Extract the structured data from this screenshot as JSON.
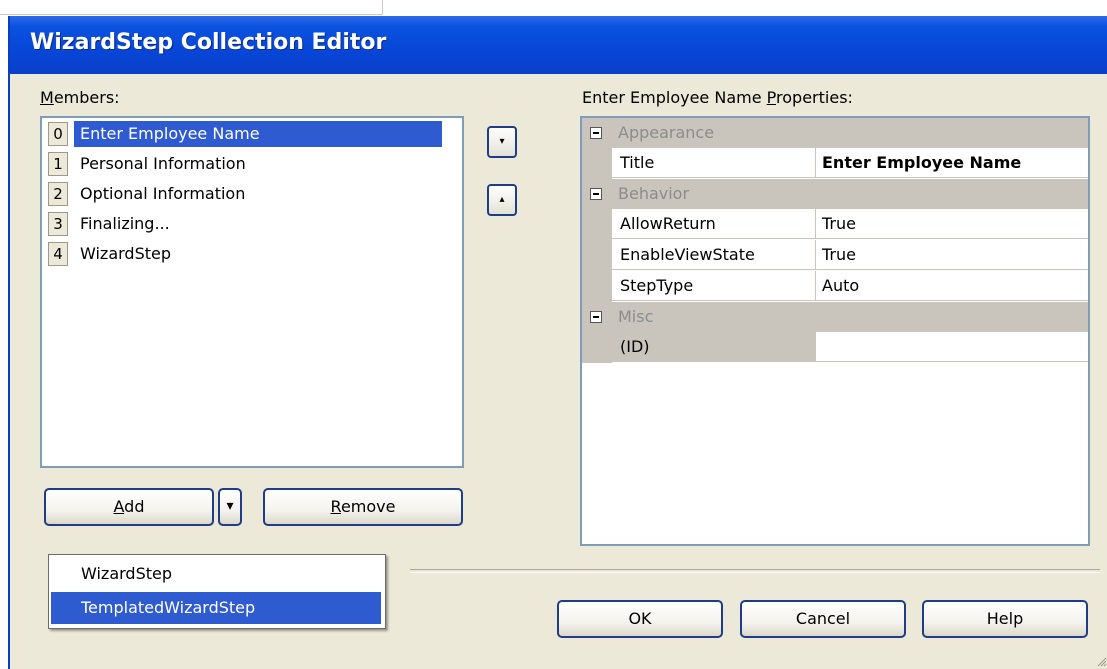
{
  "window": {
    "title": "WizardStep Collection Editor"
  },
  "members": {
    "label_hotkey": "M",
    "label_rest": "embers:",
    "items": [
      {
        "index": "0",
        "name": "Enter Employee Name"
      },
      {
        "index": "1",
        "name": "Personal Information"
      },
      {
        "index": "2",
        "name": "Optional Information"
      },
      {
        "index": "3",
        "name": "Finalizing..."
      },
      {
        "index": "4",
        "name": "WizardStep"
      }
    ],
    "selected_index": 0
  },
  "reorder": {
    "up_glyph": "▾",
    "down_glyph": "▴"
  },
  "buttons": {
    "add_hotkey": "A",
    "add_rest": "dd",
    "add_dropdown_glyph": "▾",
    "remove_hotkey": "R",
    "remove_rest": "emove",
    "ok": "OK",
    "cancel": "Cancel",
    "help": "Help"
  },
  "add_menu": {
    "items": [
      "WizardStep",
      "TemplatedWizardStep"
    ],
    "selected": "TemplatedWizardStep"
  },
  "properties": {
    "label_prefix": "Enter Employee Name ",
    "label_hotkey": "P",
    "label_rest": "roperties:",
    "categories": [
      {
        "name": "Appearance",
        "props": [
          {
            "name": "Title",
            "value": "Enter Employee Name"
          }
        ]
      },
      {
        "name": "Behavior",
        "props": [
          {
            "name": "AllowReturn",
            "value": "True"
          },
          {
            "name": "EnableViewState",
            "value": "True"
          },
          {
            "name": "StepType",
            "value": "Auto"
          }
        ]
      },
      {
        "name": "Misc",
        "props": [
          {
            "name": "(ID)",
            "value": ""
          }
        ]
      }
    ]
  },
  "colors": {
    "titlebar": "#0846d8",
    "selection": "#2f5bd0",
    "dialog_bg": "#ece9d8",
    "grid_category": "#c9c5bd",
    "button_border": "#1f3c86"
  },
  "icons": {
    "move_up": "arrow-up-icon",
    "move_down": "arrow-down-icon",
    "collapse": "minus-box-icon",
    "resize": "resize-grip-icon"
  }
}
